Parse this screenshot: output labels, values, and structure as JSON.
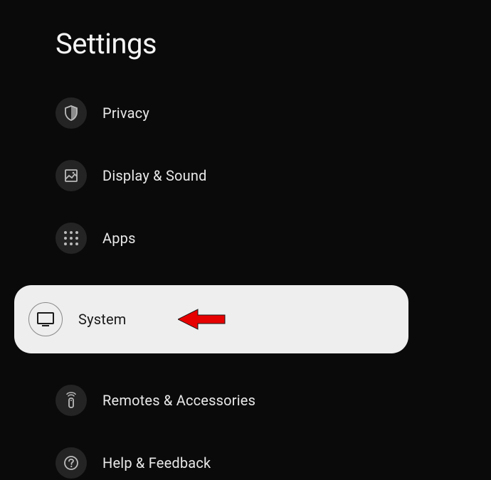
{
  "header": {
    "title": "Settings"
  },
  "menu": {
    "items": [
      {
        "id": "privacy",
        "label": "Privacy",
        "icon": "shield-icon",
        "selected": false
      },
      {
        "id": "display-sound",
        "label": "Display & Sound",
        "icon": "image-icon",
        "selected": false
      },
      {
        "id": "apps",
        "label": "Apps",
        "icon": "grid-icon",
        "selected": false
      },
      {
        "id": "system",
        "label": "System",
        "icon": "monitor-icon",
        "selected": true
      },
      {
        "id": "remotes",
        "label": "Remotes & Accessories",
        "icon": "remote-icon",
        "selected": false
      },
      {
        "id": "help",
        "label": "Help & Feedback",
        "icon": "help-icon",
        "selected": false
      }
    ]
  },
  "annotation": {
    "arrow_target": "system"
  }
}
